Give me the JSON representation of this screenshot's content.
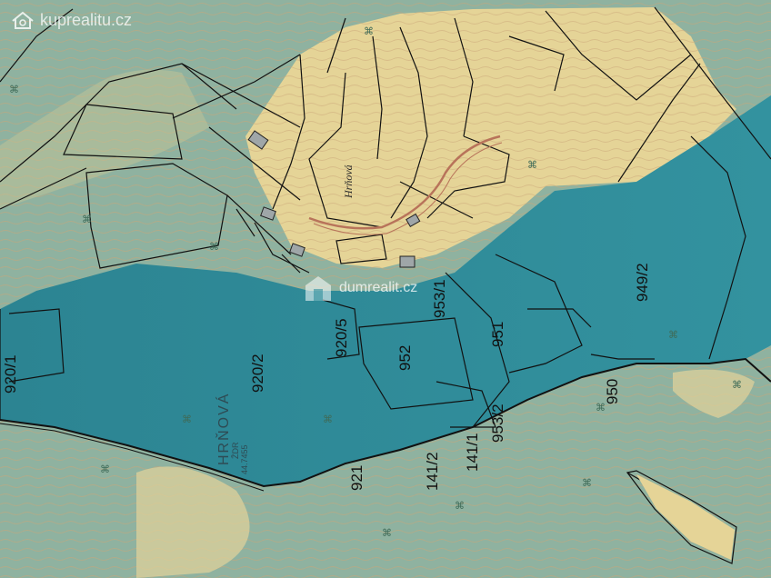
{
  "map": {
    "colors": {
      "forest": "#8fb2a0",
      "meadow": "#e5d497",
      "water": "#2f8d9b",
      "boundary": "#111111",
      "contour": "#c9a678",
      "paper": "#e9ecef"
    },
    "icons": [
      "tree-symbol-icon",
      "house-icon",
      "watermark-logo-icon"
    ]
  },
  "watermarks": {
    "top": "kuprealitu.cz",
    "center": "dumrealit.cz"
  },
  "village_label": "Hrňová",
  "reservoir": {
    "name": "HRŇOVÁ",
    "sub": "ŽDR",
    "number": "44.7455"
  },
  "parcels": [
    {
      "id": "920/1"
    },
    {
      "id": "920/2"
    },
    {
      "id": "920/5"
    },
    {
      "id": "952"
    },
    {
      "id": "953/1"
    },
    {
      "id": "951"
    },
    {
      "id": "949/2"
    },
    {
      "id": "950"
    },
    {
      "id": "953/2"
    },
    {
      "id": "141/1"
    },
    {
      "id": "141/2"
    },
    {
      "id": "921"
    }
  ]
}
